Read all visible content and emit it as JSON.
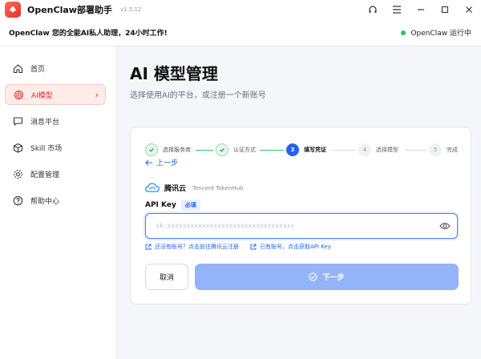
{
  "app": {
    "title": "OpenClaw部署助手",
    "version": "v1.5.12"
  },
  "window_controls": [
    "headset-icon",
    "menu-icon",
    "minimize-icon",
    "maximize-icon",
    "close-icon"
  ],
  "infobar": {
    "tagline": "OpenClaw 您的全能AI私人助理，24小时工作!",
    "status": "OpenClaw 运行中",
    "status_color": "#22c55e"
  },
  "sidebar": {
    "items": [
      {
        "label": "首页",
        "icon": "home-icon",
        "active": false
      },
      {
        "label": "AI模型",
        "icon": "brain-icon",
        "active": true
      },
      {
        "label": "消息平台",
        "icon": "chat-icon",
        "active": false
      },
      {
        "label": "Skill 市场",
        "icon": "cube-icon",
        "active": false
      },
      {
        "label": "配置管理",
        "icon": "gear-icon",
        "active": false
      },
      {
        "label": "帮助中心",
        "icon": "help-icon",
        "active": false
      }
    ]
  },
  "main": {
    "title": "AI 模型管理",
    "subtitle": "选择使用AI的平台，或注册一个新账号"
  },
  "steps": [
    {
      "num": "",
      "label": "选择服务商",
      "state": "done"
    },
    {
      "num": "",
      "label": "认证方式",
      "state": "done"
    },
    {
      "num": "3",
      "label": "填写凭证",
      "state": "current"
    },
    {
      "num": "4",
      "label": "选择模型",
      "state": "todo"
    },
    {
      "num": "5",
      "label": "完成",
      "state": "todo"
    }
  ],
  "back_label": "上一步",
  "provider": {
    "name": "腾讯云",
    "sub": "Tencent TokenHub"
  },
  "api_key": {
    "label": "API Key",
    "required": "必填",
    "placeholder": "sk-xxxxxxxxxxxxxxxxxxxxxxxxxxxxxxxxx",
    "value": ""
  },
  "links": {
    "register": "还没有账号？点击前往腾讯云注册",
    "get_key": "已有账号，点击获取API Key"
  },
  "buttons": {
    "cancel": "取消",
    "next": "下一步"
  },
  "colors": {
    "accent": "#2563eb",
    "brand": "#e0302a",
    "success": "#22c55e",
    "next_button": "#93b4f8"
  }
}
